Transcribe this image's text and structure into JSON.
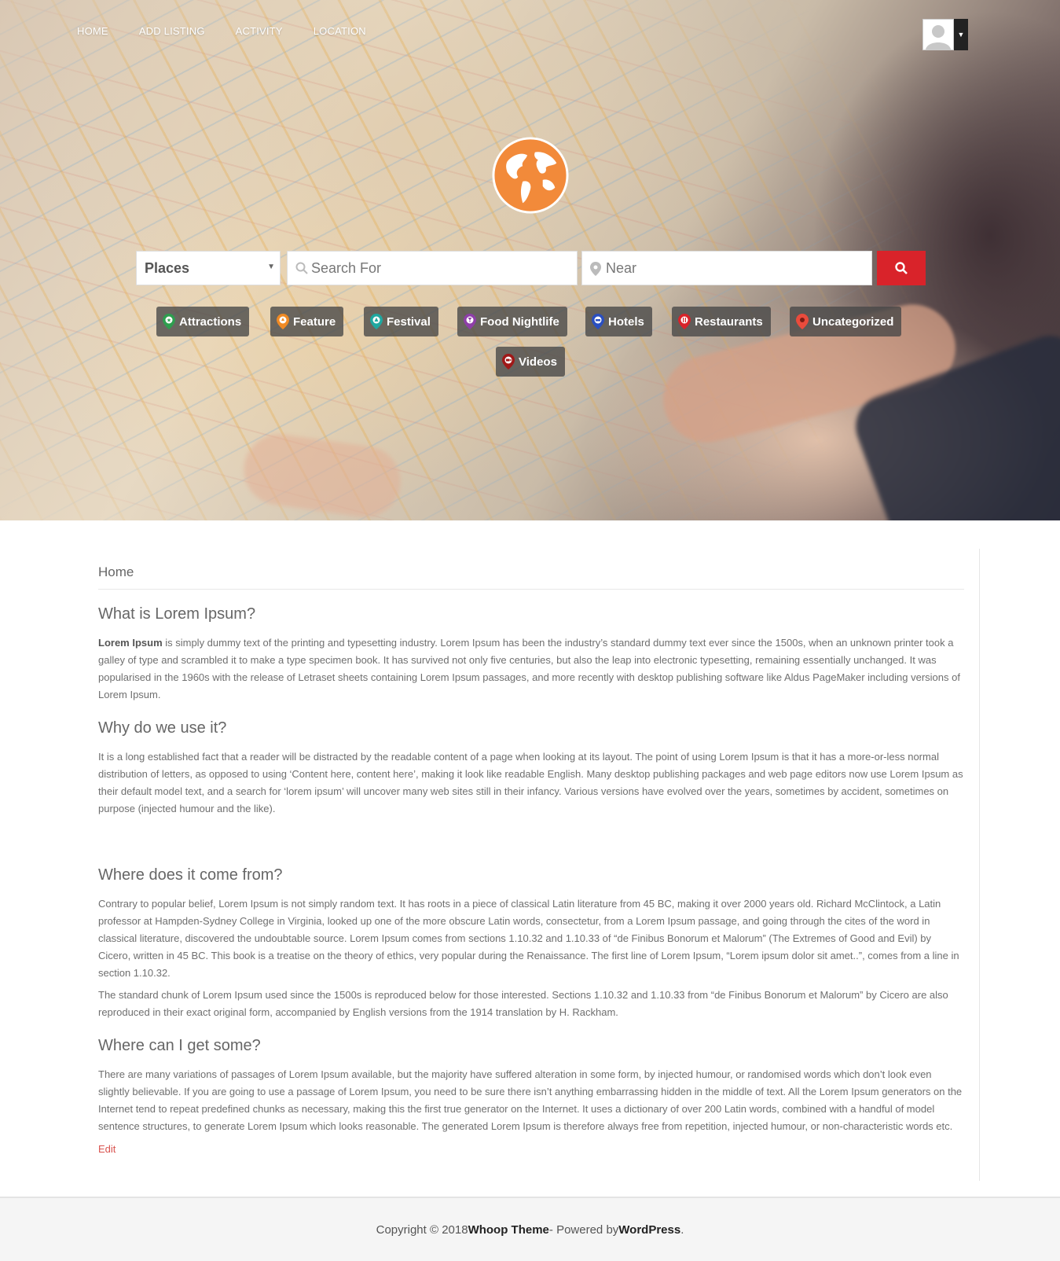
{
  "nav": {
    "items": [
      "HOME",
      "ADD LISTING",
      "ACTIVITY",
      "LOCATION"
    ]
  },
  "search": {
    "post_type_selected": "Places",
    "search_placeholder": "Search For",
    "near_placeholder": "Near"
  },
  "categories": [
    {
      "label": "Attractions",
      "pin_color": "#2e9e4f"
    },
    {
      "label": "Feature",
      "pin_color": "#f08a24"
    },
    {
      "label": "Festival",
      "pin_color": "#1fa8a0"
    },
    {
      "label": "Food Nightlife",
      "pin_color": "#8e3fa8"
    },
    {
      "label": "Hotels",
      "pin_color": "#2a4fc0"
    },
    {
      "label": "Restaurants",
      "pin_color": "#d9232a"
    },
    {
      "label": "Uncategorized",
      "pin_color": "#e94b3c"
    },
    {
      "label": "Videos",
      "pin_color": "#a01818"
    }
  ],
  "colors": {
    "accent_red": "#d9232a",
    "logo_orange": "#f28a3a"
  },
  "breadcrumb": "Home",
  "article": {
    "h1": "What is Lorem Ipsum?",
    "p1_bold": "Lorem Ipsum",
    "p1_rest": " is simply dummy text of the printing and typesetting industry. Lorem Ipsum has been the industry’s standard dummy text ever since the 1500s, when an unknown printer took a galley of type and scrambled it to make a type specimen book. It has survived not only five centuries, but also the leap into electronic typesetting, remaining essentially unchanged. It was popularised in the 1960s with the release of Letraset sheets containing Lorem Ipsum passages, and more recently with desktop publishing software like Aldus PageMaker including versions of Lorem Ipsum.",
    "h2": "Why do we use it?",
    "p2": "It is a long established fact that a reader will be distracted by the readable content of a page when looking at its layout. The point of using Lorem Ipsum is that it has a more-or-less normal distribution of letters, as opposed to using ‘Content here, content here’, making it look like readable English. Many desktop publishing packages and web page editors now use Lorem Ipsum as their default model text, and a search for ‘lorem ipsum’ will uncover many web sites still in their infancy. Various versions have evolved over the years, sometimes by accident, sometimes on purpose (injected humour and the like).",
    "h3": "Where does it come from?",
    "p3": "Contrary to popular belief, Lorem Ipsum is not simply random text. It has roots in a piece of classical Latin literature from 45 BC, making it over 2000 years old. Richard McClintock, a Latin professor at Hampden-Sydney College in Virginia, looked up one of the more obscure Latin words, consectetur, from a Lorem Ipsum passage, and going through the cites of the word in classical literature, discovered the undoubtable source. Lorem Ipsum comes from sections 1.10.32 and 1.10.33 of “de Finibus Bonorum et Malorum” (The Extremes of Good and Evil) by Cicero, written in 45 BC. This book is a treatise on the theory of ethics, very popular during the Renaissance. The first line of Lorem Ipsum, “Lorem ipsum dolor sit amet..”, comes from a line in section 1.10.32.",
    "p4": "The standard chunk of Lorem Ipsum used since the 1500s is reproduced below for those interested. Sections 1.10.32 and 1.10.33 from “de Finibus Bonorum et Malorum” by Cicero are also reproduced in their exact original form, accompanied by English versions from the 1914 translation by H. Rackham.",
    "h4": "Where can I get some?",
    "p5": "There are many variations of passages of Lorem Ipsum available, but the majority have suffered alteration in some form, by injected humour, or randomised words which don’t look even slightly believable. If you are going to use a passage of Lorem Ipsum, you need to be sure there isn’t anything embarrassing hidden in the middle of text. All the Lorem Ipsum generators on the Internet tend to repeat predefined chunks as necessary, making this the first true generator on the Internet. It uses a dictionary of over 200 Latin words, combined with a handful of model sentence structures, to generate Lorem Ipsum which looks reasonable. The generated Lorem Ipsum is therefore always free from repetition, injected humour, or non-characteristic words etc.",
    "edit": "Edit"
  },
  "footer": {
    "prefix": "Copyright © 2018 ",
    "theme": "Whoop Theme",
    "middle": " - Powered by ",
    "wp": "WordPress",
    "suffix": "."
  }
}
